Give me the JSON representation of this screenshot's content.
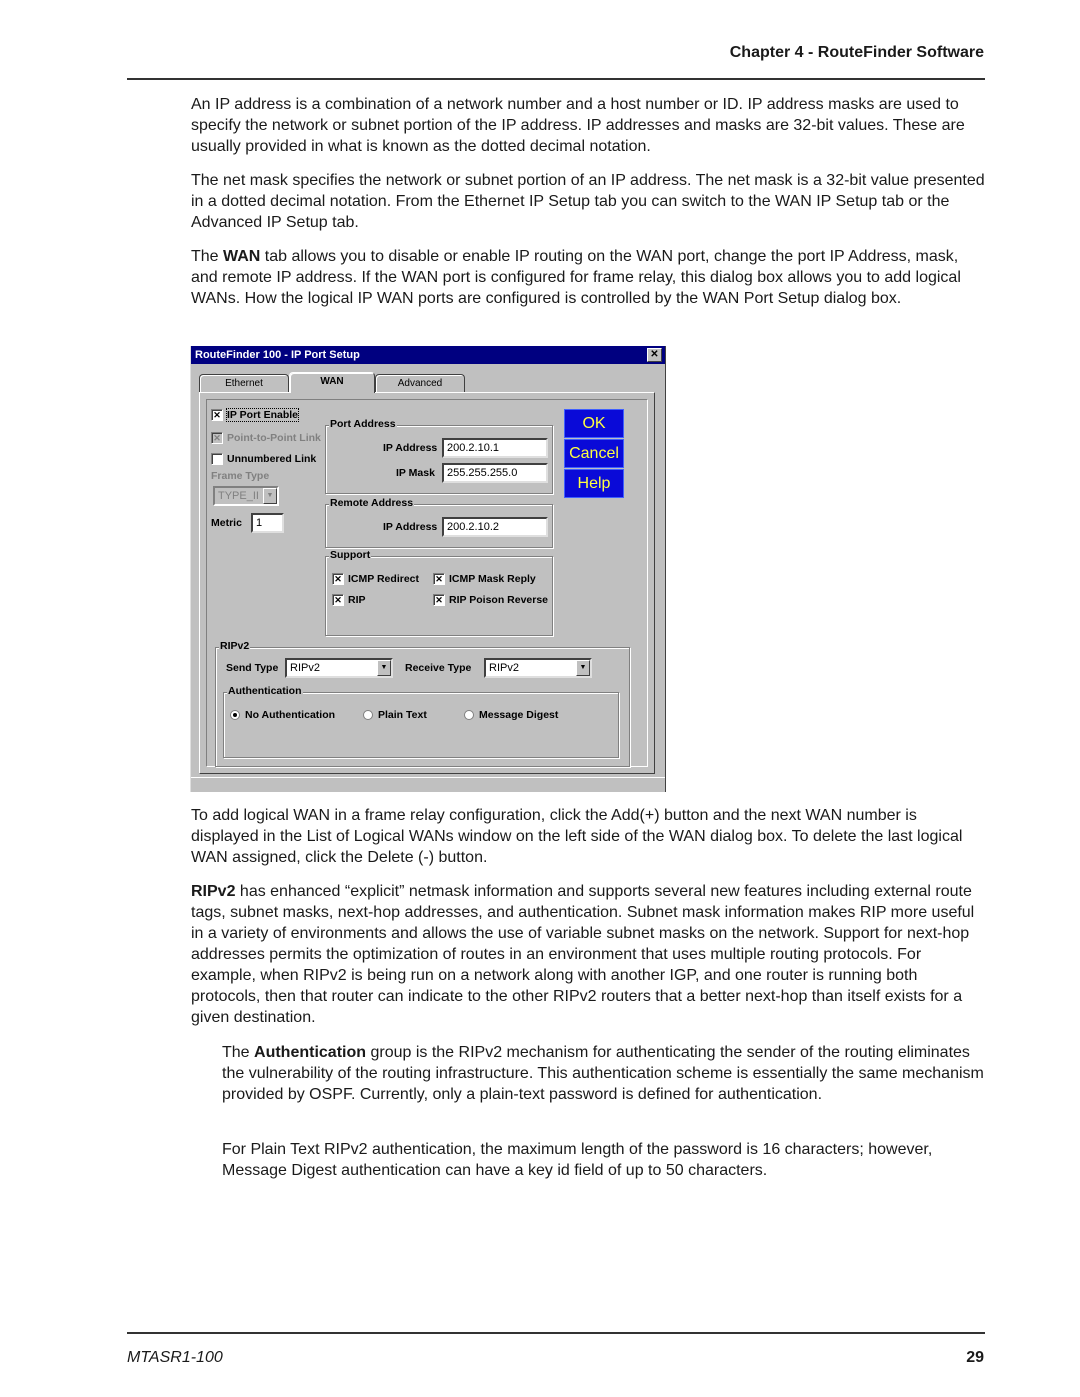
{
  "header": {
    "chapter_title": "Chapter 4 - RouteFinder Software"
  },
  "paragraphs": {
    "p1": "An IP address is a combination of a network number and a host number or ID. IP address masks are used to specify the network or subnet portion of the IP address. IP addresses and masks are 32-bit values. These are usually provided in what is known as the dotted decimal notation.",
    "p2": "The net mask specifies the network or subnet portion of an IP address. The net mask is a 32-bit value presented in a dotted decimal notation. From the Ethernet IP Setup tab you can switch to the WAN IP Setup tab or the Advanced IP Setup tab.",
    "p3_bold": "WAN",
    "p3_pre": "The ",
    "p3_post": " tab allows you to disable or enable IP routing on the WAN port, change the port IP Address, mask, and remote IP address.  If the WAN port is configured for frame relay, this dialog box allows you to add logical WANs. How the logical IP WAN ports are configured is controlled by the WAN Port Setup dialog box.",
    "p4": "To add logical WAN in a frame relay configuration, click the Add(+) button and the next WAN number is displayed in the List of Logical WANs window on the left side of the WAN dialog box.  To delete the last logical WAN assigned, click the Delete (-) button.",
    "p5_bold": "RIPv2",
    "p5_post": " has enhanced “explicit” netmask information and supports several new features including external route tags, subnet masks, next-hop addresses, and authentication. Subnet mask information makes RIP more useful in a variety of environments and allows the use of variable subnet masks on the network. Support for next-hop addresses permits the optimization of routes in an environment that uses multiple routing protocols. For example, when RIPv2 is being run on a network along with another IGP, and one router is running both protocols, then that router can indicate to the other RIPv2 routers that a better next-hop than itself exists for a given destination.",
    "p6_pre": "The ",
    "p6_bold": "Authentication",
    "p6_post": " group is the RIPv2 mechanism for authenticating the sender of the routing eliminates the vulnerability of the routing infrastructure. This authentication scheme is essentially the same mechanism provided by OSPF. Currently, only a plain-text password is defined for authentication.",
    "p7": "For Plain Text RIPv2 authentication, the maximum length of the password is 16 characters; however, Message Digest authentication can have a key id field of up to 50 characters."
  },
  "dialog": {
    "title": "RouteFinder 100 - IP Port Setup",
    "close_glyph": "✕",
    "tabs": [
      {
        "label": "Ethernet",
        "active": false
      },
      {
        "label": "WAN",
        "active": true
      },
      {
        "label": "Advanced",
        "active": false
      }
    ],
    "left": {
      "ip_port_enable": {
        "label": "IP Port Enable",
        "checked": true
      },
      "point_to_point": {
        "label": "Point-to-Point Link",
        "checked": true,
        "disabled": true
      },
      "unnumbered": {
        "label": "Unnumbered Link",
        "checked": false
      },
      "frame_type_label": "Frame Type",
      "frame_type_value": "TYPE_II",
      "metric_label": "Metric",
      "metric_value": "1"
    },
    "port_address": {
      "group_label": "Port Address",
      "ip_label": "IP Address",
      "ip_value": "200.2.10.1",
      "mask_label": "IP Mask",
      "mask_value": "255.255.255.0"
    },
    "remote_address": {
      "group_label": "Remote Address",
      "ip_label": "IP Address",
      "ip_value": "200.2.10.2"
    },
    "support": {
      "group_label": "Support",
      "icmp_redirect": {
        "label": "ICMP Redirect",
        "checked": true
      },
      "icmp_mask_reply": {
        "label": "ICMP Mask Reply",
        "checked": true
      },
      "rip": {
        "label": "RIP",
        "checked": true
      },
      "rip_poison_reverse": {
        "label": "RIP Poison Reverse",
        "checked": true
      }
    },
    "buttons": {
      "ok": "OK",
      "cancel": "Cancel",
      "help": "Help"
    },
    "ripv2": {
      "group_label": "RIPv2",
      "send_type_label": "Send Type",
      "send_type_value": "RIPv2",
      "receive_type_label": "Receive Type",
      "receive_type_value": "RIPv2",
      "auth_group_label": "Authentication",
      "auth_options": [
        {
          "label": "No Authentication",
          "selected": true
        },
        {
          "label": "Plain Text",
          "selected": false
        },
        {
          "label": "Message Digest",
          "selected": false
        }
      ]
    },
    "check_glyph": "✕",
    "arrow_glyph": "▼"
  },
  "footer": {
    "doc_id": "MTASR1-100",
    "page_number": "29"
  }
}
